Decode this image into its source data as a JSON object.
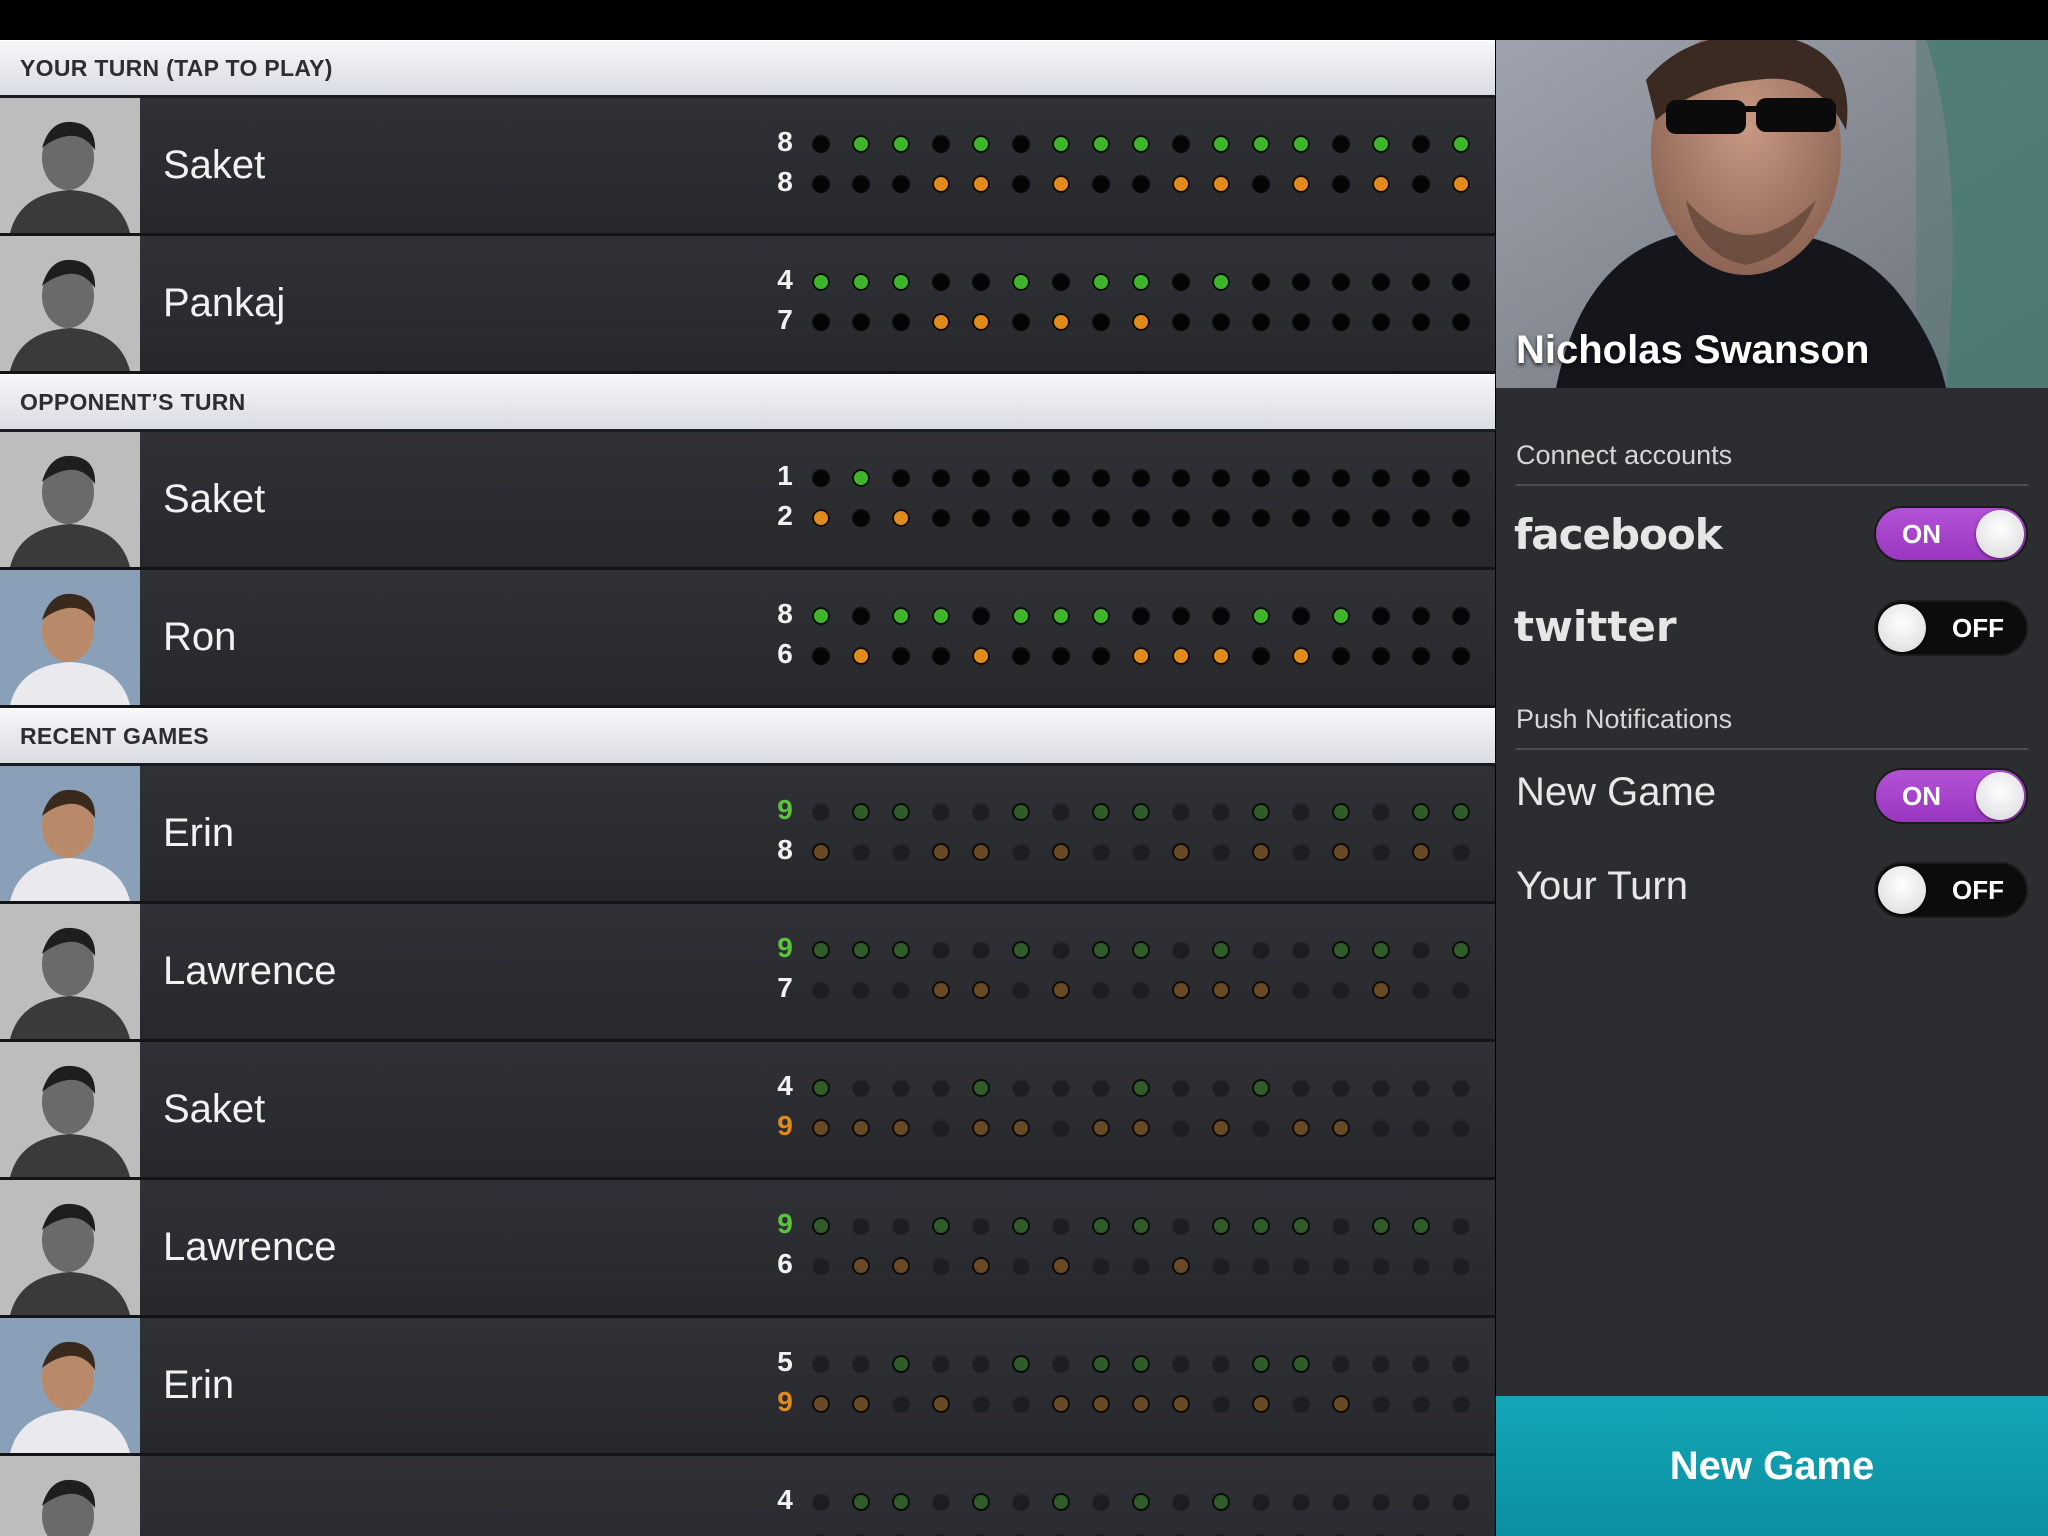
{
  "sections": {
    "your_turn": "YOUR TURN (TAP TO PLAY)",
    "opponent_turn": "OPPONENT’S TURN",
    "recent": "RECENT GAMES"
  },
  "games": [
    {
      "name": "Saket",
      "score_top": "8",
      "score_bot": "8",
      "dots_top": "01101011101110101",
      "dots_bot": "00011010011010101",
      "avatar": "gray"
    },
    {
      "name": "Pankaj",
      "score_top": "4",
      "score_bot": "7",
      "dots_top": "11100101101000000",
      "dots_bot": "00011010100000000",
      "avatar": "gray"
    },
    {
      "name": "Saket",
      "score_top": "1",
      "score_bot": "2",
      "dots_top": "01000000000000000",
      "dots_bot": "10100000000000000",
      "avatar": "gray"
    },
    {
      "name": "Ron",
      "score_top": "8",
      "score_bot": "6",
      "dots_top": "10110111000101000",
      "dots_bot": "01001000111010000",
      "avatar": "color"
    },
    {
      "name": "Erin",
      "score_top": "9",
      "score_bot": "8",
      "dots_top": "01100101100101011",
      "dots_bot": "10011010010101010",
      "avatar": "color",
      "hl": "top"
    },
    {
      "name": "Lawrence",
      "score_top": "9",
      "score_bot": "7",
      "dots_top": "11100101101001101",
      "dots_bot": "00011010011100100",
      "avatar": "gray",
      "hl": "top"
    },
    {
      "name": "Saket",
      "score_top": "4",
      "score_bot": "9",
      "dots_top": "10001000100100000",
      "dots_bot": "11101101101011000",
      "avatar": "gray",
      "hl": "bot"
    },
    {
      "name": "Lawrence",
      "score_top": "9",
      "score_bot": "6",
      "dots_top": "10010101101110110",
      "dots_bot": "01101010010000000",
      "avatar": "gray",
      "hl": "top"
    },
    {
      "name": "Erin",
      "score_top": "5",
      "score_bot": "9",
      "dots_top": "00100101100110000",
      "dots_bot": "11010011110101000",
      "avatar": "color",
      "hl": "bot"
    },
    {
      "name": "",
      "score_top": "4",
      "score_bot": "",
      "dots_top": "01101010101000000",
      "dots_bot": "00000000000000000",
      "avatar": "gray"
    }
  ],
  "profile": {
    "name": "Nicholas Swanson"
  },
  "settings": {
    "connect_label": "Connect accounts",
    "facebook": "facebook",
    "twitter": "twitter",
    "facebook_state": "ON",
    "twitter_state": "OFF",
    "push_label": "Push Notifications",
    "new_game_label": "New Game",
    "your_turn_label": "Your Turn",
    "new_game_state": "ON",
    "your_turn_state": "OFF"
  },
  "new_game_button": "New Game",
  "colors": {
    "accent": "#0ea0b2",
    "toggle_on": "#a842cc",
    "player_dot": "#3fb52c",
    "opponent_dot": "#e08a1c"
  }
}
